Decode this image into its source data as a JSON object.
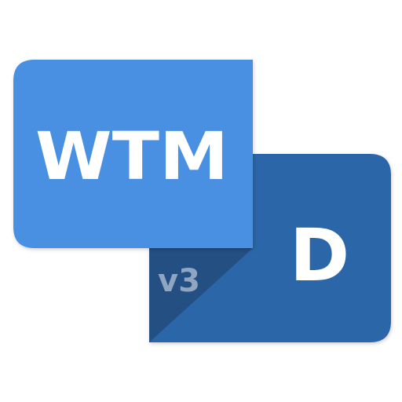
{
  "logo": {
    "primary_text": "WTM",
    "secondary_text": "D",
    "version_text": "v3",
    "colors": {
      "front_panel": "#4a90e2",
      "back_panel": "#2c66a8",
      "fold_triangle": "#234f83",
      "text": "#ffffff",
      "version_text": "#8fa6c2",
      "background": "#ffffff"
    }
  }
}
